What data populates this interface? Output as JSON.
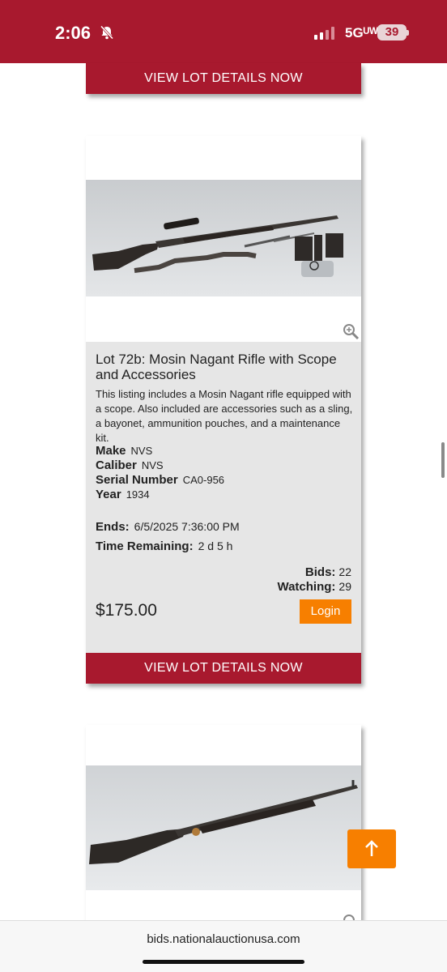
{
  "status_bar": {
    "time": "2:06",
    "network": "5Gᵁᵂ",
    "battery": "39"
  },
  "cards": {
    "top": {
      "view_label": "VIEW LOT DETAILS NOW"
    },
    "main": {
      "title": "Lot 72b:  Mosin Nagant Rifle with Scope and Accessories",
      "description": "This listing includes a Mosin Nagant rifle equipped with a scope. Also included are accessories such as a sling, a bayonet, ammunition pouches, and a maintenance kit.",
      "make_label": "Make",
      "make_value": "NVS",
      "caliber_label": "Caliber",
      "caliber_value": "NVS",
      "serial_label": "Serial Number",
      "serial_value": "CA0-956",
      "year_label": "Year",
      "year_value": "1934",
      "ends_label": "Ends:",
      "ends_value": "6/5/2025 7:36:00 PM",
      "remaining_label": "Time Remaining:",
      "remaining_value": "2 d  5 h",
      "bids_label": "Bids:",
      "bids_value": "22",
      "watching_label": "Watching:",
      "watching_value": "29",
      "price": "$175.00",
      "login_label": "Login",
      "view_label": "VIEW LOT DETAILS NOW"
    }
  },
  "browser": {
    "url": "bids.nationalauctionusa.com"
  },
  "colors": {
    "brand_red": "#a8192e",
    "accent_orange": "#f77f00",
    "card_info_bg": "#e6e6e6"
  },
  "icons": [
    "bell-muted-icon",
    "signal-icon",
    "battery-icon",
    "zoom-icon",
    "arrow-up-icon"
  ]
}
